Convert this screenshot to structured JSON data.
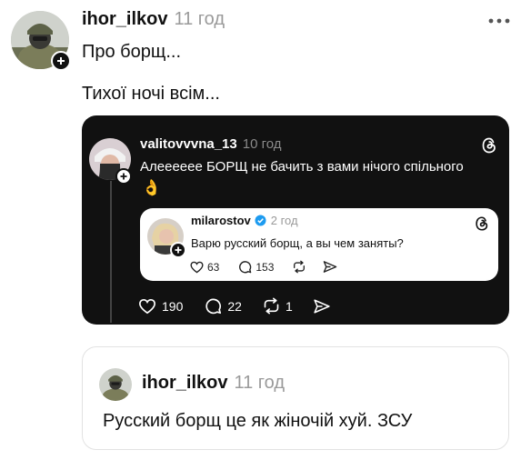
{
  "post": {
    "username": "ihor_ilkov",
    "time": "11 год",
    "line1": "Про борщ...",
    "line2": "Тихої ночі всім..."
  },
  "quoted": {
    "username": "valitovvvna_13",
    "time": "10 год",
    "text": "Алееееее БОРЩ не бачить з вами нічого спільного",
    "emoji": "👌",
    "likes": "190",
    "comments": "22",
    "reposts": "1"
  },
  "nested": {
    "username": "milarostov",
    "time": "2 год",
    "text": "Варю русский борщ, а вы чем заняты?",
    "likes": "63",
    "comments": "153"
  },
  "reply": {
    "username": "ihor_ilkov",
    "time": "11 год",
    "text": "Русский борщ це як жіночій хуй. ЗСУ"
  },
  "colors": {
    "dark_card": "#111111",
    "verified": "#1d9bf0",
    "muted": "#9a9a9a"
  },
  "icons": [
    "more-icon",
    "threads-logo-icon",
    "heart-icon",
    "comment-icon",
    "repost-icon",
    "share-icon",
    "plus-icon",
    "verified-icon"
  ]
}
